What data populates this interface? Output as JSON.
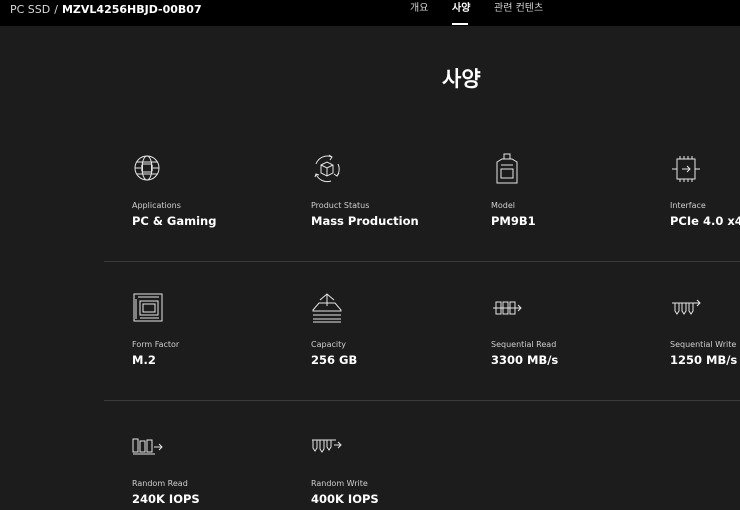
{
  "header": {
    "category": "PC SSD",
    "separator": "/",
    "model": "MZVL4256HBJD-00B07",
    "tabs": [
      {
        "label": "개요"
      },
      {
        "label": "사양"
      },
      {
        "label": "관련 컨텐츠"
      }
    ],
    "active_tab": "사양"
  },
  "main": {
    "title": "사양",
    "specs": [
      {
        "icon": "globe-chip-icon",
        "label": "Applications",
        "value": "PC & Gaming"
      },
      {
        "icon": "cycle-box-icon",
        "label": "Product Status",
        "value": "Mass Production"
      },
      {
        "icon": "ssd-tag-icon",
        "label": "Model",
        "value": "PM9B1"
      },
      {
        "icon": "chip-interface-icon",
        "label": "Interface",
        "value": "PCIe 4.0 x4"
      },
      {
        "icon": "circuit-board-icon",
        "label": "Form Factor",
        "value": "M.2"
      },
      {
        "icon": "tray-upload-icon",
        "label": "Capacity",
        "value": "256 GB"
      },
      {
        "icon": "sequential-read-icon",
        "label": "Sequential Read",
        "value": "3300 MB/s"
      },
      {
        "icon": "sequential-write-icon",
        "label": "Sequential Write",
        "value": "1250 MB/s"
      },
      {
        "icon": "random-read-icon",
        "label": "Random Read",
        "value": "240K IOPS"
      },
      {
        "icon": "random-write-icon",
        "label": "Random Write",
        "value": "400K IOPS"
      }
    ]
  }
}
